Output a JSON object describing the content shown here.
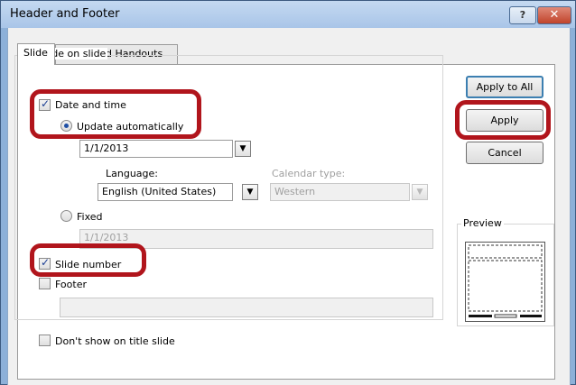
{
  "window": {
    "title": "Header and Footer",
    "help_glyph": "?",
    "close_glyph": "✕"
  },
  "tabs": [
    {
      "label": "Slide"
    },
    {
      "label": "Notes and Handouts"
    }
  ],
  "group_label": "Include on slide",
  "date_and_time": {
    "label": "Date and time",
    "checked": true
  },
  "update_automatically": {
    "label": "Update automatically",
    "selected": true
  },
  "date_format": {
    "value": "1/1/2013"
  },
  "language": {
    "label": "Language:",
    "value": "English (United States)"
  },
  "calendar_type": {
    "label": "Calendar type:",
    "value": "Western"
  },
  "fixed": {
    "label": "Fixed",
    "value": "1/1/2013"
  },
  "slide_number": {
    "label": "Slide number",
    "checked": true
  },
  "footer": {
    "label": "Footer",
    "value": ""
  },
  "dont_show_title": {
    "label": "Don't show on title slide",
    "checked": false
  },
  "buttons": {
    "apply_to_all": "Apply to All",
    "apply": "Apply",
    "cancel": "Cancel"
  },
  "preview_label": "Preview",
  "dropdown_glyph": "▼",
  "colors": {
    "highlight": "#b1151c",
    "title_bar": "#b8cfec",
    "check": "#1c3f93"
  }
}
